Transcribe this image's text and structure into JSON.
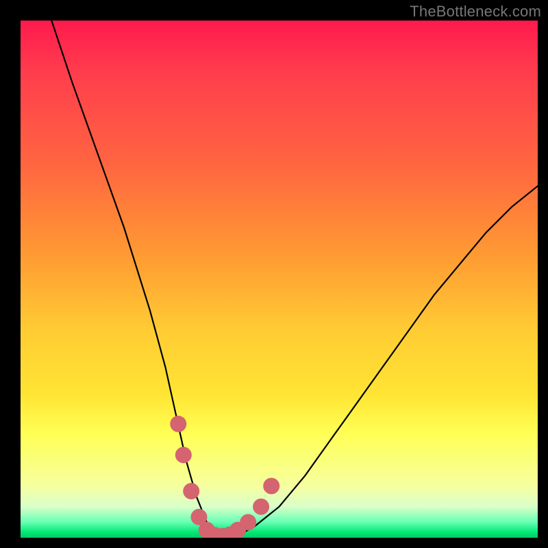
{
  "watermark": "TheBottleneck.com",
  "chart_data": {
    "type": "line",
    "title": "",
    "xlabel": "",
    "ylabel": "",
    "xlim": [
      0,
      100
    ],
    "ylim": [
      0,
      100
    ],
    "grid": false,
    "legend": false,
    "series": [
      {
        "name": "bottleneck-curve",
        "x": [
          6,
          10,
          15,
          20,
          25,
          28,
          30,
          32,
          34,
          36,
          38,
          40,
          42,
          45,
          50,
          55,
          60,
          65,
          70,
          75,
          80,
          85,
          90,
          95,
          100
        ],
        "y": [
          100,
          88,
          74,
          60,
          44,
          33,
          24,
          15,
          8,
          3,
          0.5,
          0.2,
          0.5,
          2,
          6,
          12,
          19,
          26,
          33,
          40,
          47,
          53,
          59,
          64,
          68
        ]
      }
    ],
    "markers": {
      "name": "highlight-points",
      "color": "#d4646f",
      "points": [
        {
          "x": 30.5,
          "y": 22
        },
        {
          "x": 31.5,
          "y": 16
        },
        {
          "x": 33,
          "y": 9
        },
        {
          "x": 34.5,
          "y": 4
        },
        {
          "x": 36,
          "y": 1.5
        },
        {
          "x": 37.5,
          "y": 0.5
        },
        {
          "x": 39,
          "y": 0.3
        },
        {
          "x": 40.5,
          "y": 0.6
        },
        {
          "x": 42,
          "y": 1.5
        },
        {
          "x": 44,
          "y": 3
        },
        {
          "x": 46.5,
          "y": 6
        },
        {
          "x": 48.5,
          "y": 10
        }
      ]
    },
    "background_gradient": {
      "direction": "vertical",
      "stops": [
        {
          "pos": 0.0,
          "color": "#ff1a4d"
        },
        {
          "pos": 0.45,
          "color": "#ff9933"
        },
        {
          "pos": 0.8,
          "color": "#ffff55"
        },
        {
          "pos": 0.97,
          "color": "#66ffb3"
        },
        {
          "pos": 1.0,
          "color": "#00cc66"
        }
      ]
    }
  }
}
